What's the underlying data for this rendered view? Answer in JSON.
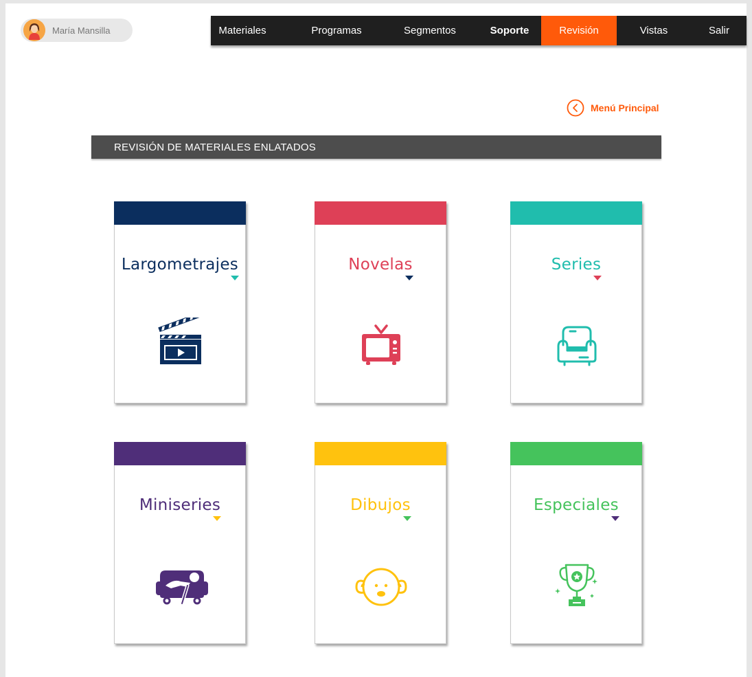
{
  "user": {
    "name": "María Mansilla"
  },
  "nav": {
    "items": [
      {
        "label": "Materiales",
        "bold": false,
        "active": false
      },
      {
        "label": "Programas",
        "bold": false,
        "active": false
      },
      {
        "label": "Segmentos",
        "bold": false,
        "active": false
      },
      {
        "label": "Soporte",
        "bold": true,
        "active": false
      },
      {
        "label": "Revisión",
        "bold": false,
        "active": true
      },
      {
        "label": "Vistas",
        "bold": false,
        "active": false
      },
      {
        "label": "Salir",
        "bold": false,
        "active": false
      }
    ]
  },
  "back_link": {
    "label": "Menú Principal"
  },
  "section": {
    "title": "REVISIÓN DE MATERIALES ENLATADOS"
  },
  "colors": {
    "accent": "#ff5a0a",
    "navy": "#0b2e5e",
    "red": "#de4057",
    "teal": "#20bdad",
    "purple": "#4f2e79",
    "yellow": "#ffc20e",
    "green": "#45c35c"
  },
  "cards": [
    {
      "label": "Largometrajes",
      "color": "#0b2e5e",
      "marker_color": "#20bdad",
      "icon": "clapperboard-icon"
    },
    {
      "label": "Novelas",
      "color": "#de4057",
      "marker_color": "#0b2e5e",
      "icon": "tv-icon"
    },
    {
      "label": "Series",
      "color": "#20bdad",
      "marker_color": "#de4057",
      "icon": "armchair-icon"
    },
    {
      "label": "Miniseries",
      "color": "#4f2e79",
      "marker_color": "#ffc20e",
      "icon": "couch-person-icon"
    },
    {
      "label": "Dibujos",
      "color": "#ffc20e",
      "marker_color": "#45c35c",
      "icon": "cartoon-face-icon"
    },
    {
      "label": "Especiales",
      "color": "#45c35c",
      "marker_color": "#4f2e79",
      "icon": "trophy-icon"
    }
  ]
}
